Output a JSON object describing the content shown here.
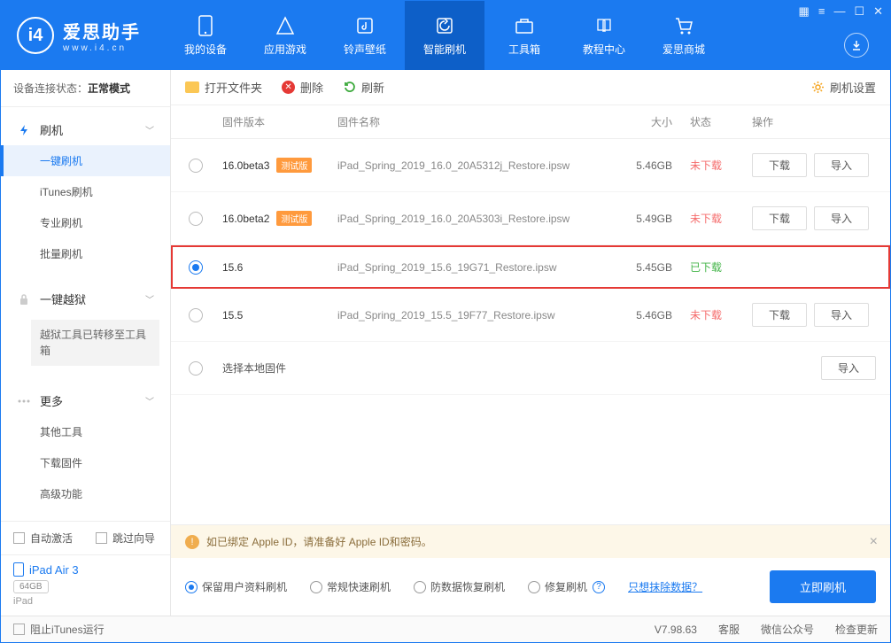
{
  "app": {
    "name": "爱思助手",
    "url": "www.i4.cn"
  },
  "nav": {
    "items": [
      {
        "label": "我的设备"
      },
      {
        "label": "应用游戏"
      },
      {
        "label": "铃声壁纸"
      },
      {
        "label": "智能刷机"
      },
      {
        "label": "工具箱"
      },
      {
        "label": "教程中心"
      },
      {
        "label": "爱思商城"
      }
    ]
  },
  "status": {
    "prefix": "设备连接状态：",
    "value": "正常模式"
  },
  "sidebar": {
    "flash_head": "刷机",
    "items": [
      "一键刷机",
      "iTunes刷机",
      "专业刷机",
      "批量刷机"
    ],
    "jailbreak_head": "一键越狱",
    "jailbreak_notice": "越狱工具已转移至工具箱",
    "more_head": "更多",
    "more_items": [
      "其他工具",
      "下载固件",
      "高级功能"
    ],
    "auto_activate": "自动激活",
    "skip_guide": "跳过向导"
  },
  "device": {
    "name": "iPad Air 3",
    "capacity": "64GB",
    "type": "iPad"
  },
  "toolbar": {
    "open": "打开文件夹",
    "delete": "删除",
    "refresh": "刷新",
    "settings": "刷机设置"
  },
  "table": {
    "headers": {
      "ver": "固件版本",
      "name": "固件名称",
      "size": "大小",
      "status": "状态",
      "ops": "操作"
    }
  },
  "firmware": [
    {
      "version": "16.0beta3",
      "beta": "测试版",
      "name": "iPad_Spring_2019_16.0_20A5312j_Restore.ipsw",
      "size": "5.46GB",
      "status": "未下载",
      "downloaded": false,
      "selected": false
    },
    {
      "version": "16.0beta2",
      "beta": "测试版",
      "name": "iPad_Spring_2019_16.0_20A5303i_Restore.ipsw",
      "size": "5.49GB",
      "status": "未下载",
      "downloaded": false,
      "selected": false
    },
    {
      "version": "15.6",
      "beta": "",
      "name": "iPad_Spring_2019_15.6_19G71_Restore.ipsw",
      "size": "5.45GB",
      "status": "已下载",
      "downloaded": true,
      "selected": true
    },
    {
      "version": "15.5",
      "beta": "",
      "name": "iPad_Spring_2019_15.5_19F77_Restore.ipsw",
      "size": "5.46GB",
      "status": "未下载",
      "downloaded": false,
      "selected": false
    }
  ],
  "local_fw": {
    "label": "选择本地固件"
  },
  "btn": {
    "download": "下载",
    "import": "导入"
  },
  "warning": "如已绑定 Apple ID，请准备好 Apple ID和密码。",
  "options": {
    "items": [
      "保留用户资料刷机",
      "常规快速刷机",
      "防数据恢复刷机",
      "修复刷机"
    ],
    "erase_link": "只想抹除数据？"
  },
  "flash_now": "立即刷机",
  "footer": {
    "block_itunes": "阻止iTunes运行",
    "version": "V7.98.63",
    "items": [
      "客服",
      "微信公众号",
      "检查更新"
    ]
  }
}
